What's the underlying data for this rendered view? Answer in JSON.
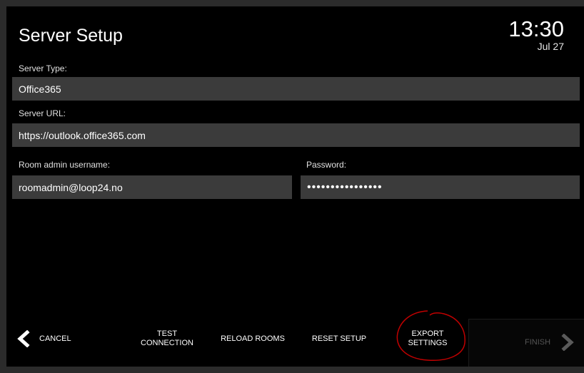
{
  "header": {
    "title": "Server Setup",
    "time": "13:30",
    "date": "Jul 27"
  },
  "form": {
    "server_type_label": "Server Type:",
    "server_type_value": "Office365",
    "server_url_label": "Server URL:",
    "server_url_value": "https://outlook.office365.com",
    "username_label": "Room admin username:",
    "username_value": "roomadmin@loop24.no",
    "password_label": "Password:",
    "password_value": "••••••••••••••••"
  },
  "toolbar": {
    "cancel_label": "CANCEL",
    "test_connection_line1": "TEST",
    "test_connection_line2": "CONNECTION",
    "reload_rooms_label": "RELOAD ROOMS",
    "reset_setup_label": "RESET SETUP",
    "export_settings_line1": "EXPORT",
    "export_settings_line2": "SETTINGS",
    "finish_label": "FINISH"
  },
  "colors": {
    "background": "#000000",
    "field": "#3b3b3b",
    "annotation": "#c00000",
    "disabled_text": "#555555"
  },
  "icons": [
    "chevron-left-icon",
    "chevron-right-icon"
  ]
}
